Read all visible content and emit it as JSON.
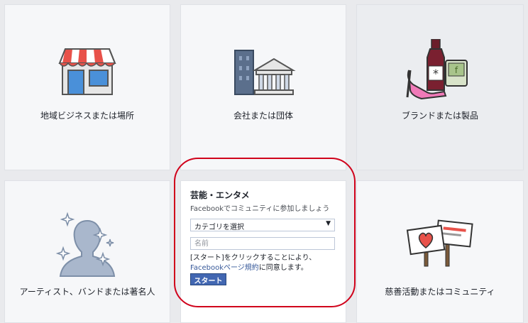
{
  "tiles": {
    "local_business": {
      "label": "地域ビジネスまたは場所"
    },
    "company": {
      "label": "会社または団体"
    },
    "brand": {
      "label": "ブランドまたは製品"
    },
    "artist": {
      "label": "アーティスト、バンドまたは著名人"
    },
    "cause": {
      "label": "慈善活動またはコミュニティ"
    }
  },
  "form": {
    "title": "芸能・エンタメ",
    "subtitle": "Facebookでコミュニティに参加しましょう",
    "select_value": "カテゴリを選択",
    "name_placeholder": "名前",
    "terms_prefix": "[スタート]をクリックすることにより、",
    "terms_link": "Facebookページ規約",
    "terms_suffix": "に同意します。",
    "start_label": "スタート"
  },
  "colors": {
    "accent": "#4267b2",
    "link": "#365899",
    "highlight_ring": "#d0021b"
  }
}
